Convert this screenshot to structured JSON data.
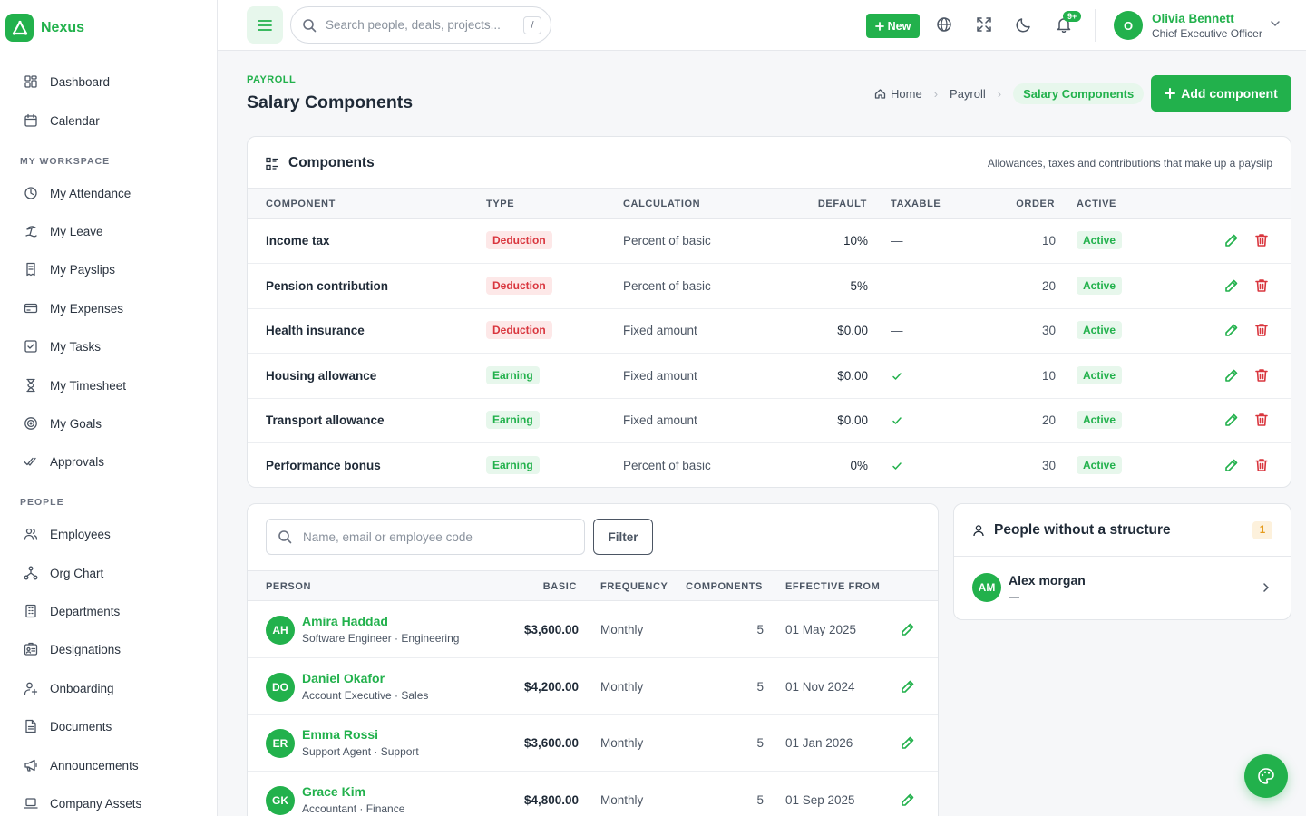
{
  "brand": {
    "name": "Nexus"
  },
  "sidebar": {
    "top": [
      {
        "label": "Dashboard",
        "icon": "dashboard-icon"
      },
      {
        "label": "Calendar",
        "icon": "calendar-icon"
      }
    ],
    "sections": [
      {
        "title": "MY WORKSPACE",
        "items": [
          {
            "label": "My Attendance",
            "icon": "clock-icon"
          },
          {
            "label": "My Leave",
            "icon": "beach-icon"
          },
          {
            "label": "My Payslips",
            "icon": "receipt-icon"
          },
          {
            "label": "My Expenses",
            "icon": "card-icon"
          },
          {
            "label": "My Tasks",
            "icon": "checkbox-icon"
          },
          {
            "label": "My Timesheet",
            "icon": "hourglass-icon"
          },
          {
            "label": "My Goals",
            "icon": "target-icon"
          },
          {
            "label": "Approvals",
            "icon": "double-check-icon"
          }
        ]
      },
      {
        "title": "PEOPLE",
        "items": [
          {
            "label": "Employees",
            "icon": "users-icon"
          },
          {
            "label": "Org Chart",
            "icon": "org-chart-icon"
          },
          {
            "label": "Departments",
            "icon": "building-icon"
          },
          {
            "label": "Designations",
            "icon": "id-card-icon"
          },
          {
            "label": "Onboarding",
            "icon": "user-plus-icon"
          },
          {
            "label": "Documents",
            "icon": "document-icon"
          },
          {
            "label": "Announcements",
            "icon": "megaphone-icon"
          },
          {
            "label": "Company Assets",
            "icon": "laptop-icon"
          }
        ]
      }
    ]
  },
  "topbar": {
    "search_placeholder": "Search people, deals, projects...",
    "search_shortcut": "/",
    "new_label": "New",
    "notifications_badge": "9+",
    "user": {
      "initial": "O",
      "name": "Olivia Bennett",
      "role": "Chief Executive Officer"
    }
  },
  "page": {
    "kicker": "PAYROLL",
    "title": "Salary Components",
    "breadcrumbs": [
      "Home",
      "Payroll",
      "Salary Components"
    ],
    "add_label": "Add component"
  },
  "components": {
    "title": "Components",
    "subtitle": "Allowances, taxes and contributions that make up a payslip",
    "columns": [
      "COMPONENT",
      "TYPE",
      "CALCULATION",
      "DEFAULT",
      "TAXABLE",
      "ORDER",
      "ACTIVE"
    ],
    "rows": [
      {
        "name": "Income tax",
        "type": "Deduction",
        "calc": "Percent of basic",
        "default": "10%",
        "taxable": false,
        "order": "10",
        "active": "Active"
      },
      {
        "name": "Pension contribution",
        "type": "Deduction",
        "calc": "Percent of basic",
        "default": "5%",
        "taxable": false,
        "order": "20",
        "active": "Active"
      },
      {
        "name": "Health insurance",
        "type": "Deduction",
        "calc": "Fixed amount",
        "default": "$0.00",
        "taxable": false,
        "order": "30",
        "active": "Active"
      },
      {
        "name": "Housing allowance",
        "type": "Earning",
        "calc": "Fixed amount",
        "default": "$0.00",
        "taxable": true,
        "order": "10",
        "active": "Active"
      },
      {
        "name": "Transport allowance",
        "type": "Earning",
        "calc": "Fixed amount",
        "default": "$0.00",
        "taxable": true,
        "order": "20",
        "active": "Active"
      },
      {
        "name": "Performance bonus",
        "type": "Earning",
        "calc": "Percent of basic",
        "default": "0%",
        "taxable": true,
        "order": "30",
        "active": "Active"
      }
    ],
    "taxable_no": "—"
  },
  "people": {
    "search_placeholder": "Name, email or employee code",
    "filter_label": "Filter",
    "columns": [
      "PERSON",
      "BASIC",
      "FREQUENCY",
      "COMPONENTS",
      "EFFECTIVE FROM"
    ],
    "rows": [
      {
        "initials": "AH",
        "name": "Amira Haddad",
        "sub": "Software Engineer · Engineering",
        "basic": "$3,600.00",
        "freq": "Monthly",
        "components": "5",
        "from": "01 May 2025"
      },
      {
        "initials": "DO",
        "name": "Daniel Okafor",
        "sub": "Account Executive · Sales",
        "basic": "$4,200.00",
        "freq": "Monthly",
        "components": "5",
        "from": "01 Nov 2024"
      },
      {
        "initials": "ER",
        "name": "Emma Rossi",
        "sub": "Support Agent · Support",
        "basic": "$3,600.00",
        "freq": "Monthly",
        "components": "5",
        "from": "01 Jan 2026"
      },
      {
        "initials": "GK",
        "name": "Grace Kim",
        "sub": "Accountant · Finance",
        "basic": "$4,800.00",
        "freq": "Monthly",
        "components": "5",
        "from": "01 Sep 2025"
      }
    ]
  },
  "no_structure": {
    "title": "People without a structure",
    "count": "1",
    "person": {
      "initials": "AM",
      "name": "Alex morgan",
      "sub": "—"
    }
  },
  "colors": {
    "accent": "#22b14c",
    "danger": "#d9363e",
    "warning": "#e59a1a"
  }
}
